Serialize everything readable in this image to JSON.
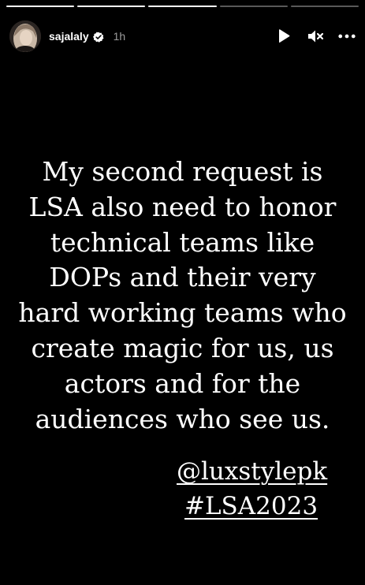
{
  "progress": {
    "segments": [
      {
        "fill": "100%"
      },
      {
        "fill": "100%"
      },
      {
        "fill": "100%"
      },
      {
        "fill": "0%"
      },
      {
        "fill": "0%"
      }
    ]
  },
  "header": {
    "username": "sajalaly",
    "time": "1h",
    "icons": {
      "avatar": "profile-photo",
      "verified": "verified-badge-icon",
      "play": "play-icon",
      "mute": "muted-speaker-icon",
      "more": "more-dots-icon"
    }
  },
  "story": {
    "lines": [
      "My second request is",
      "LSA also need to honor",
      "technical teams like",
      "DOPs and their very",
      "hard working teams who",
      "create magic for us, us",
      "actors and for the",
      "audiences who see us."
    ],
    "mention": "@luxstylepk",
    "hashtag": "#LSA2023"
  },
  "colors": {
    "background": "#000000",
    "text": "#ffffff",
    "muted": "#999999"
  }
}
